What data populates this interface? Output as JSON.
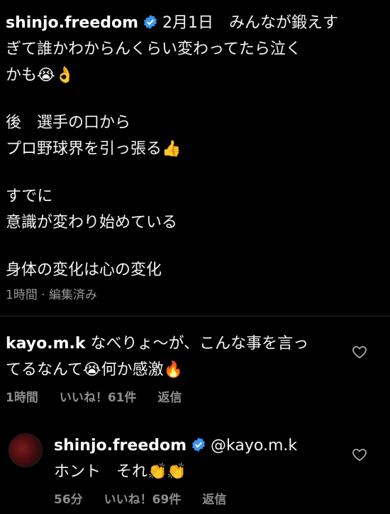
{
  "post": {
    "username": "shinjo.freedom",
    "date": "2月1日",
    "lines": [
      "みんなが鍛えす",
      "ぎて誰かわからんくらい変わってたら泣く",
      "かも😭👌",
      "後　選手の口から",
      "プロ野球界を引っ張る👍",
      "すでに",
      "意識が変わり始めている",
      "身体の変化は心の変化"
    ],
    "meta": "1時間 · 編集済み"
  },
  "comments": [
    {
      "username": "kayo.m.k",
      "line1": "なべりょ〜が、こんな事を言っ",
      "line2": "てるなんて😭何か感激🔥",
      "time": "1時間",
      "likes": "いいね！61件",
      "reply": "返信"
    },
    {
      "username": "shinjo.freedom",
      "mention": "@kayo.m.k",
      "line1": "ホント　それ👏👏",
      "time": "56分",
      "likes": "いいね！69件",
      "reply": "返信"
    }
  ],
  "icons": {
    "verified": "verified-badge-icon",
    "heart": "heart-outline-icon"
  },
  "colors": {
    "background": "#000000",
    "text": "#f5f5f5",
    "meta": "#8e8e8e",
    "verified": "#3897f0"
  }
}
